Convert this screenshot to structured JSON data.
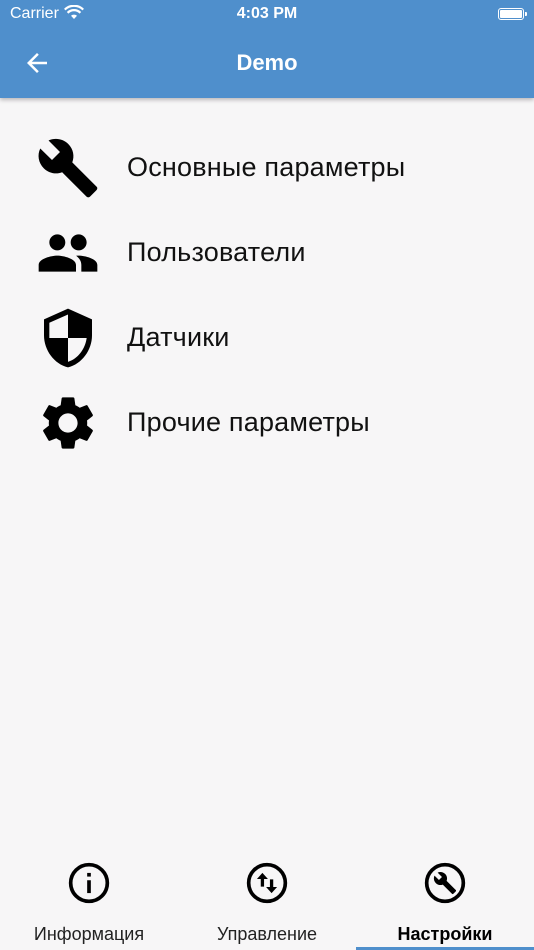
{
  "status": {
    "carrier": "Carrier",
    "time": "4:03 PM"
  },
  "appbar": {
    "title": "Demo",
    "back_icon": "arrow-left-icon"
  },
  "menu": [
    {
      "label": "Основные параметры",
      "icon": "wrench-icon"
    },
    {
      "label": "Пользователи",
      "icon": "people-icon"
    },
    {
      "label": "Датчики",
      "icon": "shield-icon"
    },
    {
      "label": "Прочие параметры",
      "icon": "gear-icon"
    }
  ],
  "tabs": [
    {
      "label": "Информация",
      "icon": "info-icon",
      "active": false
    },
    {
      "label": "Управление",
      "icon": "swap-vert-icon",
      "active": false
    },
    {
      "label": "Настройки",
      "icon": "build-icon",
      "active": true
    }
  ],
  "colors": {
    "accent": "#4f8fcc",
    "background": "#f7f6f7",
    "text": "#111111"
  }
}
